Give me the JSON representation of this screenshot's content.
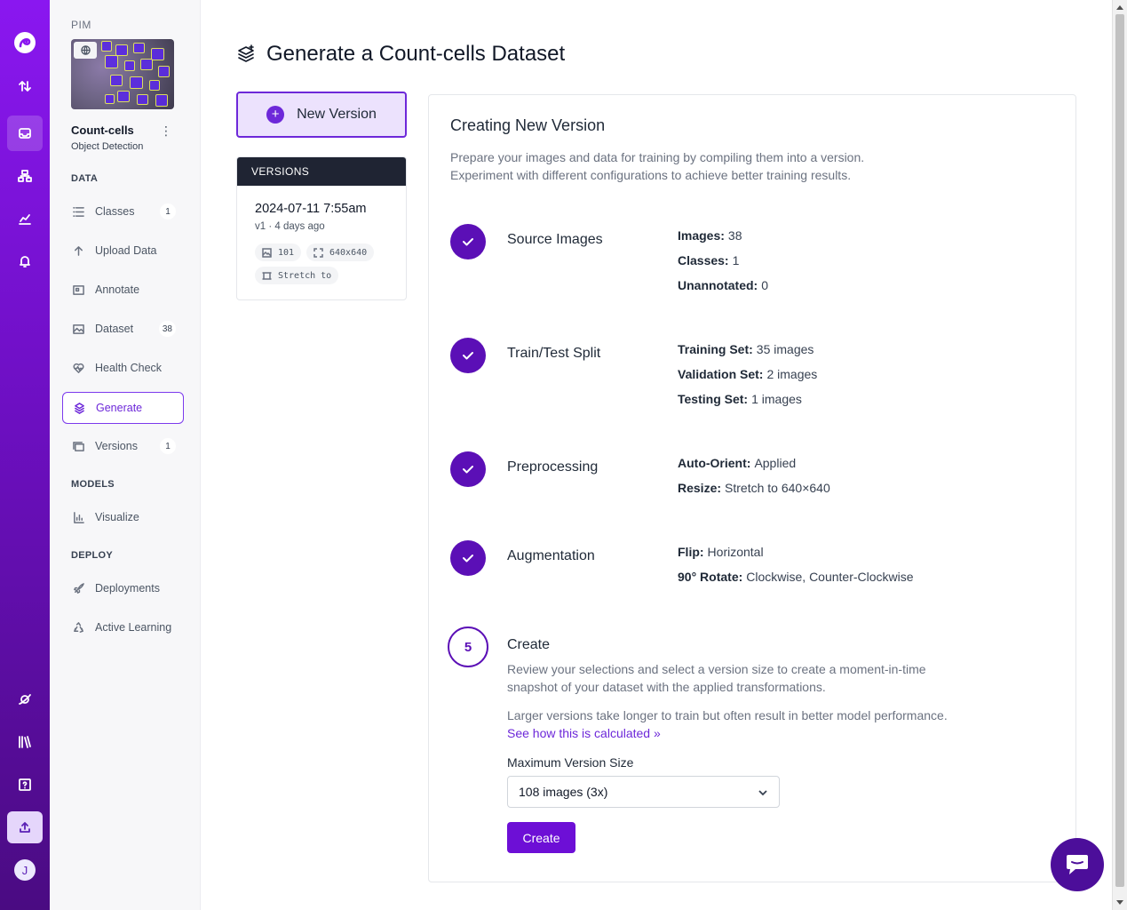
{
  "sidebar": {
    "workspace": "PIM",
    "project": {
      "name": "Count-cells",
      "type": "Object Detection"
    },
    "sections": {
      "data": "DATA",
      "models": "MODELS",
      "deploy": "DEPLOY"
    },
    "items": [
      {
        "label": "Classes",
        "badge": "1"
      },
      {
        "label": "Upload Data"
      },
      {
        "label": "Annotate"
      },
      {
        "label": "Dataset",
        "badge": "38"
      },
      {
        "label": "Health Check"
      },
      {
        "label": "Generate",
        "active": true
      },
      {
        "label": "Versions",
        "badge": "1"
      },
      {
        "label": "Visualize"
      },
      {
        "label": "Deployments"
      },
      {
        "label": "Active Learning"
      }
    ],
    "avatar_initial": "J"
  },
  "header": {
    "title": "Generate a Count-cells Dataset"
  },
  "new_version": {
    "label": "New Version"
  },
  "versions": {
    "heading": "VERSIONS",
    "items": [
      {
        "date": "2024-07-11 7:55am",
        "meta": "v1 · 4 days ago",
        "images": "101",
        "size": "640x640",
        "transform": "Stretch to"
      }
    ]
  },
  "panel": {
    "title": "Creating New Version",
    "desc1": "Prepare your images and data for training by compiling them into a version.",
    "desc2": "Experiment with different configurations to achieve better training results.",
    "steps": {
      "source": {
        "title": "Source Images",
        "rows": [
          {
            "k": "Images:",
            "v": "38"
          },
          {
            "k": "Classes:",
            "v": "1"
          },
          {
            "k": "Unannotated:",
            "v": "0"
          }
        ]
      },
      "split": {
        "title": "Train/Test Split",
        "rows": [
          {
            "k": "Training Set:",
            "v": "35 images"
          },
          {
            "k": "Validation Set:",
            "v": "2 images"
          },
          {
            "k": "Testing Set:",
            "v": "1 images"
          }
        ]
      },
      "preprocessing": {
        "title": "Preprocessing",
        "rows": [
          {
            "k": "Auto-Orient:",
            "v": "Applied"
          },
          {
            "k": "Resize:",
            "v": "Stretch to 640×640"
          }
        ]
      },
      "augmentation": {
        "title": "Augmentation",
        "rows": [
          {
            "k": "Flip:",
            "v": "Horizontal"
          },
          {
            "k": "90° Rotate:",
            "v": "Clockwise, Counter-Clockwise"
          }
        ]
      },
      "create": {
        "number": "5",
        "title": "Create",
        "text1": "Review your selections and select a version size to create a moment-in-time snapshot of your dataset with the applied transformations.",
        "text2": "Larger versions take longer to train but often result in better model performance.",
        "link": "See how this is calculated",
        "size_label": "Maximum Version Size",
        "size_value": "108 images (3x)",
        "button": "Create"
      }
    }
  },
  "colors": {
    "brand": "#6d0fd6",
    "step": "#5b0fb6",
    "rail_top": "#8a17f0",
    "rail_bottom": "#4a0b82"
  }
}
